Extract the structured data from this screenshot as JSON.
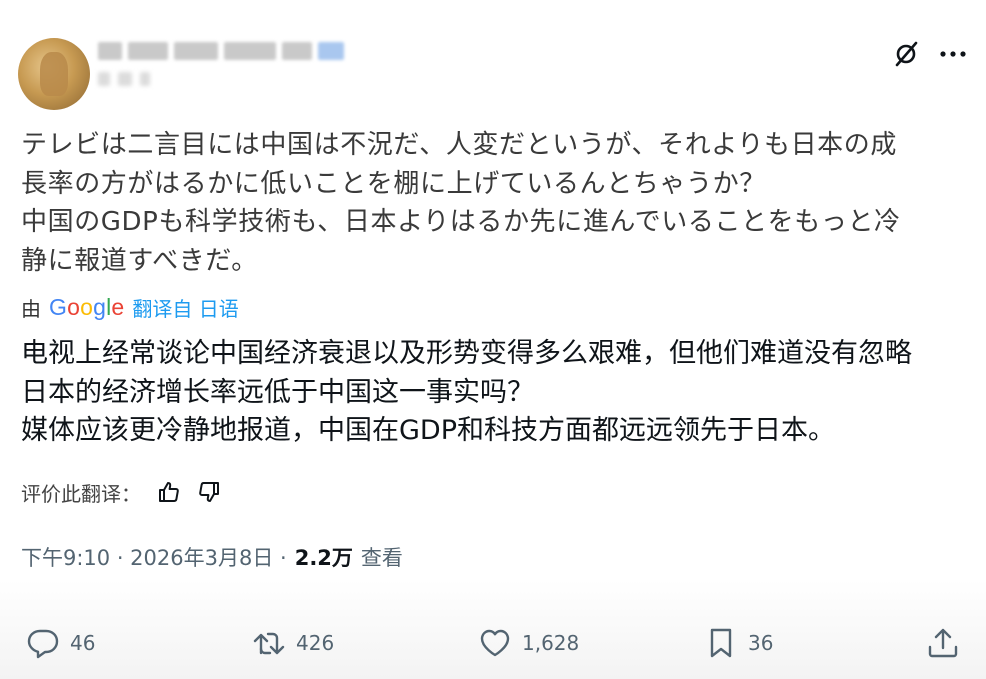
{
  "post": {
    "original_text": [
      "テレビは二言目には中国は不況だ、人変だというが、それよりも日本の成",
      "長率の方がはるかに低いことを棚に上げているんとちゃうか？",
      "中国のGDPも科学技術も、日本よりはるか先に進んでいることをもっと冷",
      "静に報道すべきだ。"
    ],
    "translated_by_prefix": "由",
    "google_logo_text": "Google",
    "translated_from_label": "翻译自 日语",
    "translated_text": [
      "电视上经常谈论中国经济衰退以及形势变得多么艰难，但他们难道没有忽略",
      "日本的经济增长率远低于中国这一事实吗？",
      "媒体应该更冷静地报道，中国在GDP和科技方面都远远领先于日本。"
    ],
    "rate_translation_label": "评价此翻译：",
    "timestamp": "下午9:10 · 2026年3月8日 ·",
    "views_count": "2.2万",
    "views_label": "查看"
  },
  "actions": {
    "reply_count": "46",
    "repost_count": "426",
    "like_count": "1,628",
    "bookmark_count": "36"
  },
  "icons": [
    "grok-icon",
    "more-icon",
    "thumbs-up-icon",
    "thumbs-down-icon",
    "reply-icon",
    "repost-icon",
    "like-icon",
    "bookmark-icon",
    "share-icon"
  ],
  "colors": {
    "link_blue": "#1d9bf0",
    "secondary_text": "#536471",
    "primary_text": "#0f1419"
  }
}
